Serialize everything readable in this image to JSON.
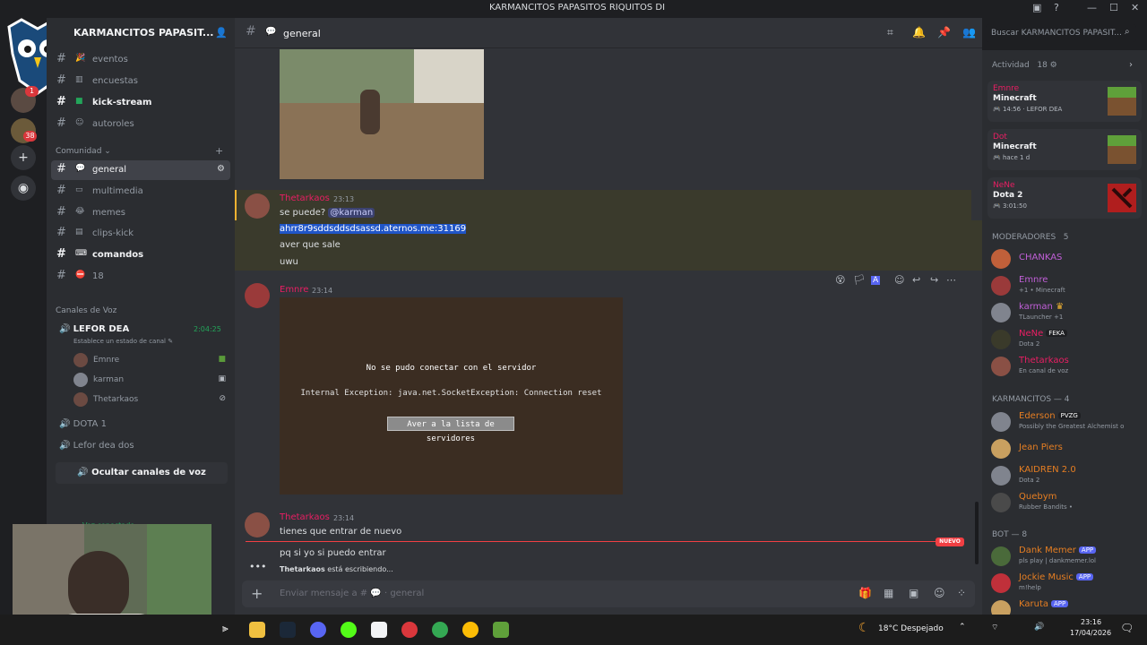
{
  "window": {
    "title": "KARMANCITOS PAPASITOS RIQUITOS DI"
  },
  "colors": {
    "accent": "#5865f2",
    "online": "#23a55a",
    "unread_red": "#f23f43",
    "mod_pink": "#e91e63"
  },
  "guilds": {
    "badge_top": "1",
    "badge_bottom": "38",
    "add_icon": "plus-icon",
    "discover_icon": "compass-icon"
  },
  "server": {
    "name": "KARMANCITOS PAPASIT..."
  },
  "channels": {
    "top": [
      {
        "name": "eventos"
      },
      {
        "name": "encuestas"
      },
      {
        "name": "kick-stream"
      },
      {
        "name": "autoroles"
      }
    ],
    "category": "Comunidad",
    "community": [
      {
        "name": "general"
      },
      {
        "name": "multimedia"
      },
      {
        "name": "memes"
      },
      {
        "name": "clips-kick"
      },
      {
        "name": "comandos"
      },
      {
        "name": "18"
      }
    ],
    "voice_category": "Canales de Voz",
    "voice_main": {
      "name": "LEFOR DEA",
      "time": "2:04:25",
      "status_hint": "Establece un estado de canal"
    },
    "voice_users": [
      "Emnre",
      "karman",
      "Thetarkaos"
    ],
    "voice_others": [
      "DOTA 1",
      "Lefor dea dos"
    ],
    "hide_voice_label": "Ocultar canales de voz",
    "hidden_partial": "Voz conectado"
  },
  "header": {
    "channel": "general",
    "search_placeholder": "Buscar KARMANCITOS PAPASIT..."
  },
  "messages": [
    {
      "author": "Thetarkaos",
      "time": "23:13",
      "lines": [
        "se puede?",
        "ahrr8r9sddsddsdsassd.aternos.me:31169",
        "aver que sale",
        "uwu"
      ],
      "mention": "@karman"
    },
    {
      "author": "Emnre",
      "time": "23:14"
    },
    {
      "author": "Thetarkaos",
      "time": "23:14",
      "lines": [
        "tienes que entrar de nuevo",
        "pq si yo si puedo entrar"
      ]
    }
  ],
  "minecraft_error": {
    "line1": "No se pudo conectar con el servidor",
    "line2": "Internal Exception: java.net.SocketException: Connection reset",
    "button": "Aver a la lista de servidores"
  },
  "new_badge": "NUEVO",
  "typing": {
    "user": "Thetarkaos",
    "text": "está escribiendo..."
  },
  "composer": {
    "placeholder": "Enviar mensaje a #",
    "channel": "general"
  },
  "activity": {
    "title": "Actividad",
    "count": "18",
    "cards": [
      {
        "name": "Emnre",
        "game": "Minecraft",
        "detail": "14:56 · LEFOR DEA"
      },
      {
        "name": "Dot",
        "game": "Minecraft",
        "detail": "hace 1 d"
      },
      {
        "name": "NeNe",
        "game": "Dota 2",
        "detail": "3:01:50"
      }
    ]
  },
  "members": {
    "mods_title": "MODERADORES",
    "mods_count": "5",
    "mods": [
      {
        "name": "CHANKAS",
        "status": ""
      },
      {
        "name": "Emnre",
        "status": "+1 • Minecraft"
      },
      {
        "name": "karman",
        "status": "TLauncher +1"
      },
      {
        "name": "NeNe",
        "tag": "FEKA",
        "status": "Dota 2"
      },
      {
        "name": "Thetarkaos",
        "status": "En canal de voz"
      }
    ],
    "group_title": "KARMANCITOS — 4",
    "group": [
      {
        "name": "Ederson",
        "tag": "PVZG",
        "status": "Possibly the Greatest Alchemist o"
      },
      {
        "name": "Jean Piers",
        "status": ""
      },
      {
        "name": "KAIDREN 2.0",
        "status": "Dota 2"
      },
      {
        "name": "Quebym",
        "status": "Rubber Bandits •"
      }
    ],
    "bot_title": "BOT — 8",
    "bots": [
      {
        "name": "Dank Memer",
        "tag": "APP",
        "status": "pls play | dankmemer.lol"
      },
      {
        "name": "Jockie Music",
        "tag": "APP",
        "status": "m!help"
      },
      {
        "name": "Karuta",
        "tag": "APP",
        "status": ""
      }
    ]
  },
  "taskbar": {
    "weather": "18°C  Despejado",
    "time": "23:16",
    "date": "17/04/2026"
  }
}
